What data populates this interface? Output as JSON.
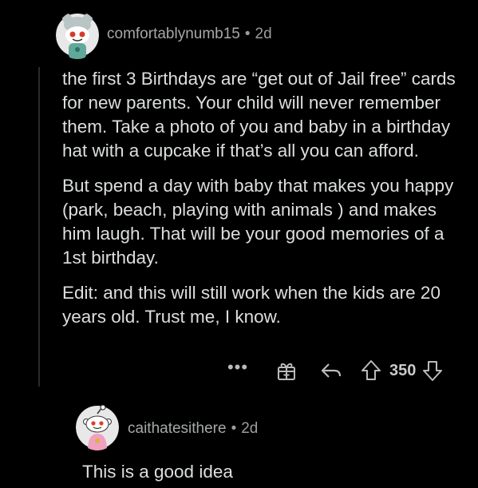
{
  "comment": {
    "username": "comfortablynumb15",
    "separator": "•",
    "age": "2d",
    "paragraphs": [
      "the first 3 Birthdays are “get out of Jail free” cards for new parents. Your child will never remember them. Take a photo of you and baby in a birthday hat with a cupcake if that’s all you can afford.",
      "But spend a day with baby that makes you happy (park, beach, playing with animals ) and makes him laugh. That will be your good memories of a 1st birthday.",
      "Edit: and this will still work when the kids are 20 years old. Trust me, I know."
    ],
    "actions": {
      "more": "•••",
      "score": "350",
      "icons": [
        "more-options-icon",
        "award-icon",
        "reply-icon",
        "upvote-icon",
        "downvote-icon"
      ]
    }
  },
  "reply": {
    "username": "caithatesithere",
    "separator": "•",
    "age": "2d",
    "text": "This is a good idea"
  },
  "colors": {
    "background": "#000000",
    "text": "#dcdedf",
    "meta": "#9a9d9f",
    "thread_line": "#2a2a2b"
  }
}
